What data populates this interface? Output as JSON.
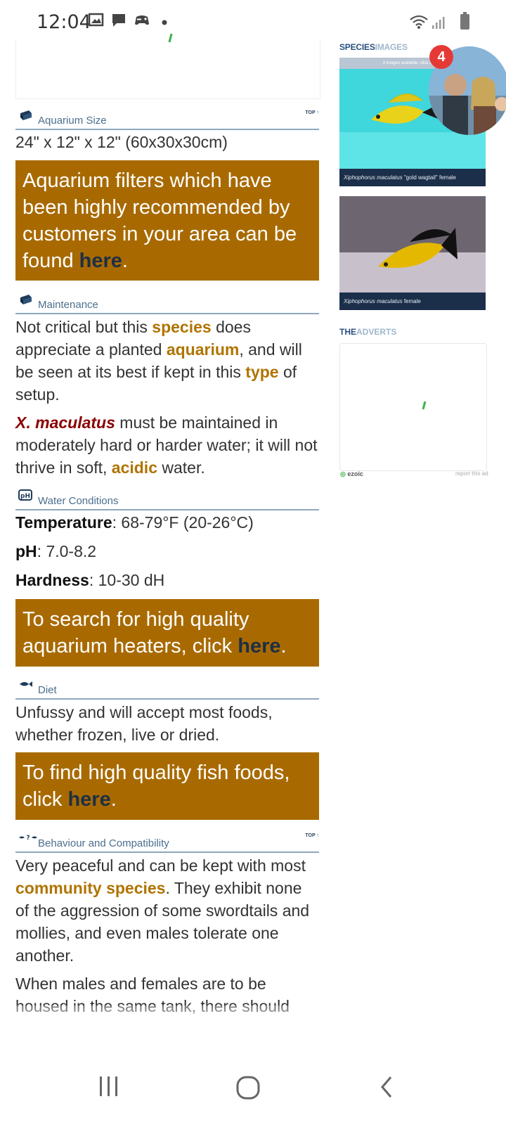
{
  "status_bar": {
    "time": "12:04",
    "left_icons": [
      "image-icon",
      "message-icon",
      "game-controller-icon",
      "dot-icon"
    ],
    "right_icons": [
      "wifi-icon",
      "signal-icon",
      "battery-icon"
    ]
  },
  "sections": {
    "aquarium_size": {
      "title": "Aquarium Size",
      "top_link": "TOP ↑",
      "text": "24\" x 12\" x 12\" (60x30x30cm)"
    },
    "filters_promo": {
      "text": "Aquarium filters which have been highly recommended by customers in your area can be found ",
      "link": "here",
      "end": "."
    },
    "maintenance": {
      "title": "Maintenance",
      "p1": {
        "a": "Not critical but this ",
        "b": "species",
        "c": " does appreciate a planted ",
        "d": "aquarium",
        "e": ", and will be seen at its best if kept in this ",
        "f": "type",
        "g": " of setup."
      },
      "p2": {
        "species": "X. maculatus",
        "a": " must be maintained in moderately hard or harder water; it will not thrive in soft, ",
        "b": "acidic",
        "c": " water."
      }
    },
    "water_conditions": {
      "title": "Water Conditions",
      "temperature_label": "Temperature",
      "temperature_value": ": 68-79°F (20-26°C)",
      "ph_label": "pH",
      "ph_value": ": 7.0-8.2",
      "hardness_label": "Hardness",
      "hardness_value": ": 10-30 dH"
    },
    "heaters_promo": {
      "text": "To search for high quality aquarium heaters, click ",
      "link": "here",
      "end": "."
    },
    "diet": {
      "title": "Diet",
      "text": "Unfussy and will accept most foods, whether frozen, live or dried."
    },
    "foods_promo": {
      "text": "To find high quality fish foods, click ",
      "link": "here",
      "end": "."
    },
    "behaviour": {
      "title": "Behaviour and Compatibility",
      "top_link": "TOP ↑",
      "p1": {
        "a": "Very peaceful and can be kept with most ",
        "b": "community species",
        "c": ". They exhibit none of the aggression of some swordtails and mollies, and even males tolerate one another."
      },
      "p2": "When males and females are to be housed in the same tank, there should"
    }
  },
  "sidebar": {
    "species_images": {
      "title_bold": "SPECIES",
      "title_light": "IMAGES",
      "note": "3 images available; click on one",
      "images": [
        {
          "caption_italic": "Xiphophorus maculatus",
          "caption_rest": " \"gold wagtail\" female"
        },
        {
          "caption_italic": "Xiphophorus maculatus",
          "caption_rest": " female"
        }
      ]
    },
    "adverts": {
      "title_bold": "THE",
      "title_light": "ADVERTS",
      "ezoic": "ezoic",
      "report": "report this ad"
    }
  },
  "chat_head": {
    "badge_count": "4"
  },
  "nav_bar": {
    "icons": [
      "recent-apps-icon",
      "home-icon",
      "back-icon"
    ]
  }
}
